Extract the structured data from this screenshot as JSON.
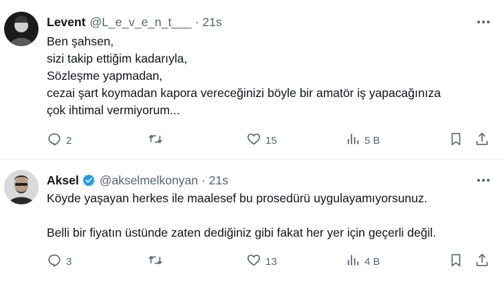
{
  "tweets": [
    {
      "name": "Levent",
      "handle": "@L_e_v_e_n_t___",
      "separator": "·",
      "time": "21s",
      "verified": false,
      "lines": [
        "Ben şahsen,",
        "sizi takip ettiğim kadarıyla,",
        "Sözleşme yapmadan,",
        "cezai şart koymadan kapora vereceğinizi böyle bir amatör iş yapacağınıza",
        "çok ihtimal vermiyorum..."
      ],
      "replies": "2",
      "retweets": "",
      "likes": "15",
      "views": "5 B"
    },
    {
      "name": "Aksel",
      "handle": "@akselmelkonyan",
      "separator": "·",
      "time": "21s",
      "verified": true,
      "lines": [
        "Köyde yaşayan herkes ile maalesef bu prosedürü uygulayamıyorsunuz.",
        "",
        "Belli bir fiyatın üstünde zaten dediğiniz gibi fakat her yer için geçerli değil."
      ],
      "replies": "3",
      "retweets": "",
      "likes": "13",
      "views": "4 B"
    }
  ],
  "icons": {
    "reply": "reply-icon",
    "retweet": "retweet-icon",
    "like": "heart-icon",
    "views": "views-icon",
    "bookmark": "bookmark-icon",
    "share": "share-icon",
    "more": "more-icon",
    "verified": "verified-badge-icon"
  },
  "colors": {
    "text": "#0f1419",
    "secondary": "#536471",
    "verified": "#1d9bf0",
    "divider": "#e6ecf0"
  }
}
